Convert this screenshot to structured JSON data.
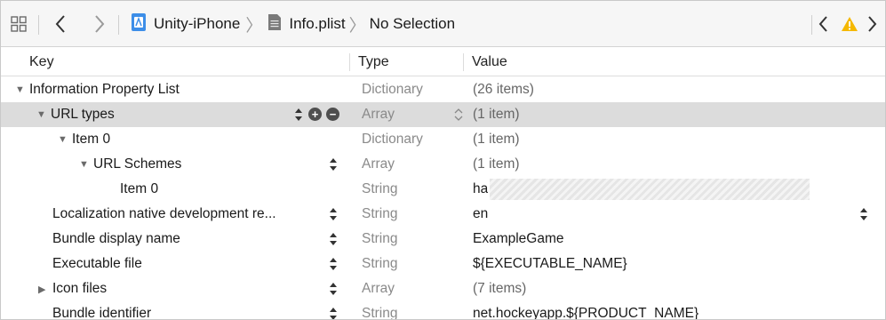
{
  "toolbar": {
    "grid_icon": "grid-icon",
    "back_icon": "chevron-left-icon",
    "forward_icon": "chevron-right-icon",
    "project": "Unity-iPhone",
    "file": "Info.plist",
    "selection": "No Selection",
    "issues_prev_icon": "chevron-left-icon",
    "warning_icon": "warning-icon",
    "issues_next_icon": "chevron-right-icon",
    "warning_color": "#f5b800"
  },
  "columns": {
    "key": "Key",
    "type": "Type",
    "value": "Value"
  },
  "rows": [
    {
      "key": "Information Property List",
      "type": "Dictionary",
      "value": "(26 items)"
    },
    {
      "key": "URL types",
      "type": "Array",
      "value": "(1 item)"
    },
    {
      "key": "Item 0",
      "type": "Dictionary",
      "value": "(1 item)"
    },
    {
      "key": "URL Schemes",
      "type": "Array",
      "value": "(1 item)"
    },
    {
      "key": "Item 0",
      "type": "String",
      "value": "ha"
    },
    {
      "key": "Localization native development re...",
      "type": "String",
      "value": "en"
    },
    {
      "key": "Bundle display name",
      "type": "String",
      "value": "ExampleGame"
    },
    {
      "key": "Executable file",
      "type": "String",
      "value": "${EXECUTABLE_NAME}"
    },
    {
      "key": "Icon files",
      "type": "Array",
      "value": "(7 items)"
    },
    {
      "key": "Bundle identifier",
      "type": "String",
      "value": "net.hockeyapp.${PRODUCT_NAME}"
    }
  ],
  "colors": {
    "selected_row": "#dcdcdc",
    "type_text": "#8a8a8a"
  }
}
